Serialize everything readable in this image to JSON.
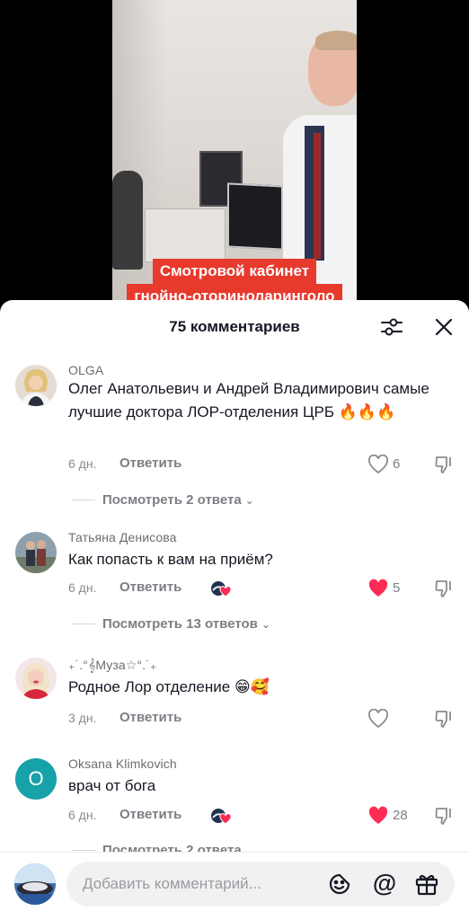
{
  "video": {
    "caption_line1": "Смотровой кабинет",
    "caption_line2": "гнойно-оториноларинголо"
  },
  "sheet": {
    "title": "75 комментариев"
  },
  "comments": [
    {
      "author": "OLGA",
      "text": "Олег Анатольевич и Андрей Владимирович самые лучшие доктора ЛОР-отделения ЦРБ 🔥🔥🔥",
      "age": "6 дн.",
      "reply_label": "Ответить",
      "likes": "6",
      "liked": false,
      "view_replies": "Посмотреть 2 ответа"
    },
    {
      "author": "Татьяна Денисова",
      "text": "Как попасть к вам на приём?",
      "age": "6 дн.",
      "reply_label": "Ответить",
      "likes": "5",
      "liked": true,
      "view_replies": "Посмотреть 13 ответов"
    },
    {
      "author": "₊˙.°𝄞Муза☆°.˙₊",
      "text": "Родное Лор отделение 😁🥰",
      "age": "3 дн.",
      "reply_label": "Ответить",
      "likes": "",
      "liked": false
    },
    {
      "author": "Oksana Klimkovich",
      "avatar_letter": "O",
      "text": "врач от бога",
      "age": "6 дн.",
      "reply_label": "Ответить",
      "likes": "28",
      "liked": true,
      "view_replies": "Посмотреть 2 ответа"
    }
  ],
  "footer": {
    "placeholder": "Добавить комментарий...",
    "mention_symbol": "@"
  },
  "colors": {
    "caption_bg": "#e8392d",
    "like_red": "#fe2c55",
    "avatar_teal": "#17a1a8"
  }
}
